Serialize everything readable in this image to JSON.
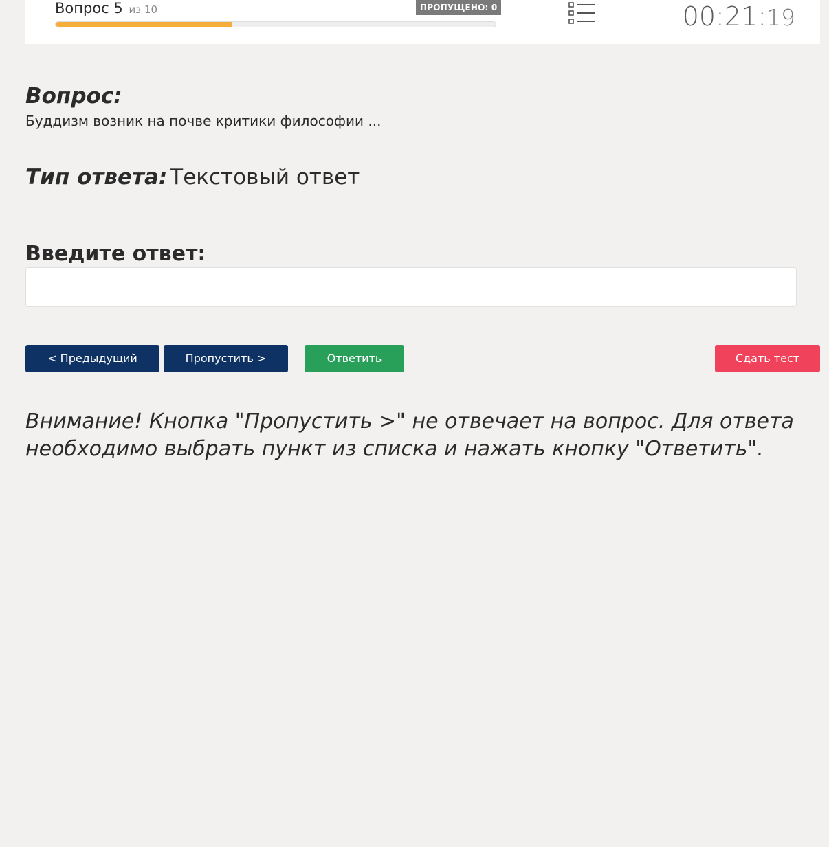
{
  "header": {
    "question_label": "Вопрос 5",
    "question_of": "из 10",
    "progress_fraction": 0.4,
    "skipped_badge": "ПРОПУЩЕНО: 0",
    "list_icon": "question-list-icon",
    "timer_main": "00:21:",
    "timer_seconds": "19"
  },
  "question": {
    "heading": "Вопрос:",
    "text": "Буддизм возник на почве критики философии ..."
  },
  "answer_type": {
    "label": "Тип ответа:",
    "value": "Текстовый ответ"
  },
  "answer": {
    "label": "Введите ответ:",
    "value": "",
    "placeholder": ""
  },
  "buttons": {
    "prev": "< Предыдущий",
    "skip": "Пропустить >",
    "answer": "Ответить",
    "submit": "Сдать тест"
  },
  "warning": "Внимание! Кнопка \"Пропустить >\" не отвечает на вопрос. Для ответа необходимо выбрать пункт из списка и нажать кнопку \"Ответить\".",
  "colors": {
    "progress": "#f5ad3b",
    "nav_button": "#0e3263",
    "answer_button": "#28a05a",
    "submit_button": "#f0425a",
    "badge": "#7a7a7a"
  }
}
